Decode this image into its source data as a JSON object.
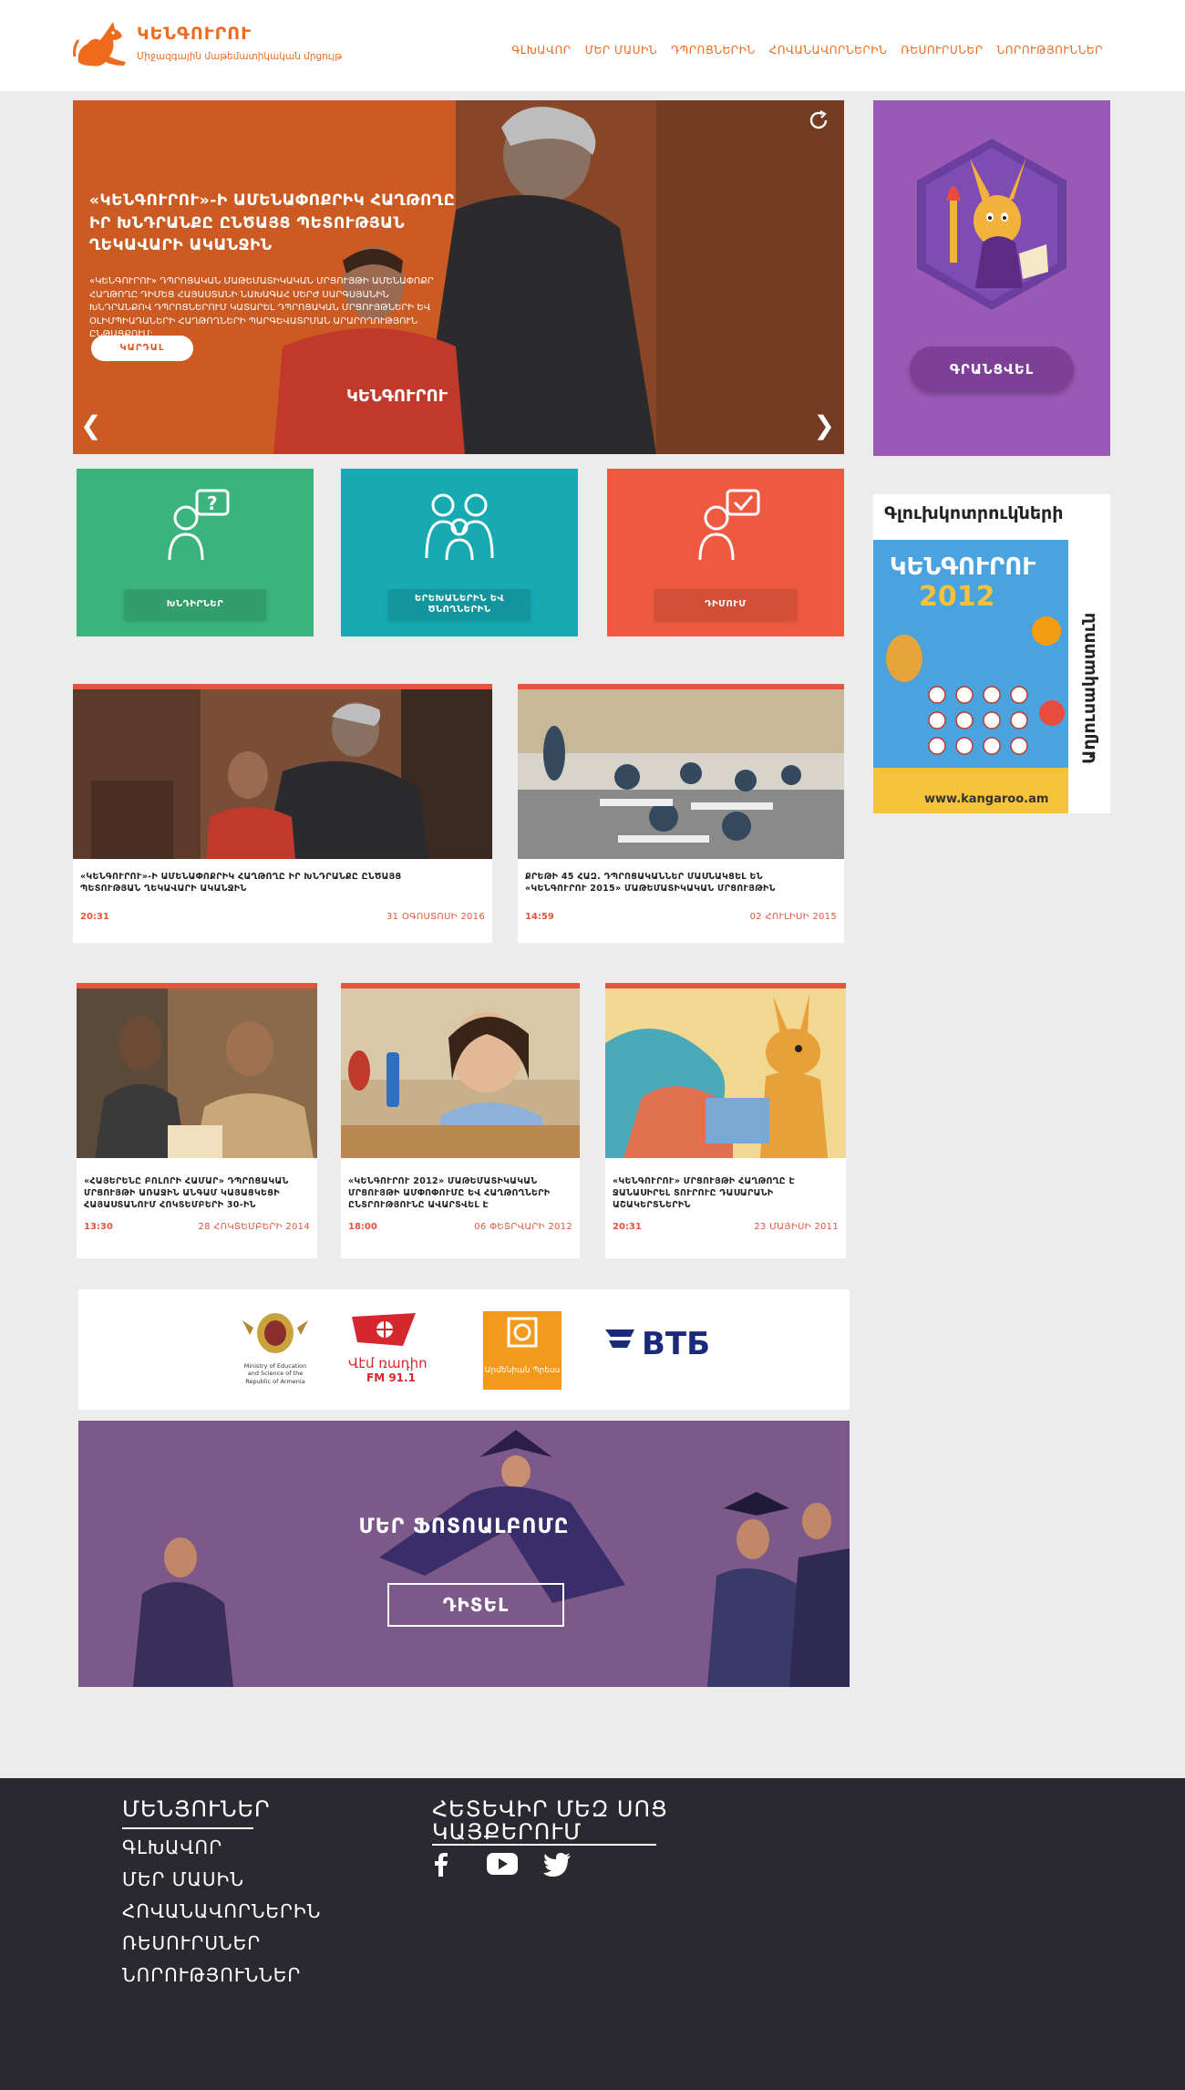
{
  "brand": {
    "name": "ԿԵՆԳՈՒՐՈՒ",
    "subtitle": "Միջազգային մաթեմատիկական մրցույթ",
    "accent": "#f06a1e"
  },
  "nav": [
    {
      "label": "ԳԼԽԱՎՈՐ"
    },
    {
      "label": "ՄԵՐ ՄԱՍԻՆ"
    },
    {
      "label": "ԴՊՐՈՑՆԵՐԻՆ"
    },
    {
      "label": "ՀՈՎԱՆԱՎՈՐՆԵՐԻՆ"
    },
    {
      "label": "ՌԵՍՈՒՐՍՆԵՐ"
    },
    {
      "label": "ՆՈՐՈՒԹՅՈՒՆՆԵՐ"
    }
  ],
  "hero": {
    "title": "«ԿԵՆԳՈՒՐՈՒ»-Ի ԱՄԵՆԱՓՈՔՐԻԿ ՀԱՂԹՈՂԸ ԻՐ ԽՆԴՐԱՆՔԸ ԸՆԾԱՅՑ ՊԵՏՈՒԹՅԱՆ ՂԵԿԱՎԱՐԻ ԱԿԱՆՋԻՆ",
    "text": "«ԿԵՆԳՈՒՐՈՒ» ԴՊՐՈՑԱԿԱՆ ՄԱԹԵՄԱՏԻԿԱԿԱՆ ՄՐՑՈՒՅԹԻ ԱՄԵՆԱՓՈՔՐ ՀԱՂԹՈՂԸ ԴԻՄԵՑ ՀԱՅԱՍՏԱՆԻ ՆԱԽԱԳԱՀ ՍԵՐԺ ՍԱՐԳՍՅԱՆԻՆ ԽՆԴՐԱՆՔՈՎ ԴՊՐՈՑՆԵՐՈՒՄ ԿԱՏԱՐԵԼ ԴՊՐՈՑԱԿԱՆ ՄՐՑՈՒՅԹՆԵՐԻ ԵՎ ՕԼԻՄՊԻԱԴԱՆԵՐԻ ՀԱՂԹՈՂՆԵՐԻ ՊԱՐԳԵՎԱՏՐՄԱՆ ԱՐԱՐՈՂՈՒԹՅՈՒՆ ԸՆԹԱՑՔՈՒՄ:",
    "button": "ԿԱՐԴԱԼ",
    "prev": "❮",
    "next": "❯"
  },
  "promo": {
    "button": "ԳՐԱՆՑՎԵԼ",
    "color": "#9b59b6"
  },
  "tiles": [
    {
      "label": "ԽՆԴԻՐՆԵՐ",
      "color": "#3bb37c",
      "icon": "child-question-icon"
    },
    {
      "label": "ԵՐԵԽԱՆԵՐԻՆ ԵՎ ԾՆՈՂՆԵՐԻՆ",
      "color": "#17aab3",
      "icon": "family-icon"
    },
    {
      "label": "ԴԻՄՈՒՄ",
      "color": "#ee5a3f",
      "icon": "child-check-icon"
    }
  ],
  "ad": {
    "title": "Գլուխկոտրուկների",
    "side": "Աղյուսակատուն",
    "poster_title": "ԿԵՆԳՈՒՐՈՒ",
    "poster_year": "2012",
    "poster_url": "www.kangaroo.am"
  },
  "news_big": [
    {
      "title": "«ԿԵՆԳՈՒՐՈՒ»-Ի ԱՄԵՆԱՓՈՔՐԻԿ ՀԱՂԹՈՂԸ ԻՐ ԽՆԴՐԱՆՔԸ ԸՆԾԱՅՑ ՊԵՏՈՒԹՅԱՆ ՂԵԿԱՎԱՐԻ ԱԿԱՆՋԻՆ",
      "time": "20:31",
      "date": "31 ՕԳՈՍՏՈՍԻ 2016"
    },
    {
      "title": "ՔՐԵԹԻ 45 ՀԱԶ. ԴՊՐՈՑԱԿԱՆՆԵՐ ՄԱՍՆԱԿՑԵԼ ԵՆ «ԿԵՆԳՈՒՐՈՒ 2015» ՄԱԹԵՄԱՏԻԿԱԿԱՆ ՄՐՑՈՒՅԹԻՆ",
      "time": "14:59",
      "date": "02 ՀՈՒԼԻՍԻ 2015"
    }
  ],
  "news_small": [
    {
      "title": "«ՀԱՅԵՐԵՆԸ ԲՈԼՈՐԻ ՀԱՄԱՐ» ԴՊՐՈՑԱԿԱՆ ՄՐՑՈՒՅԹԻ ԱՌԱՋԻՆ ԱՆԳԱՄ ԿԱՅԱՑԿԵՑԻ ՀԱՅԱՍՏԱՆՈՒՄ ՀՈԿՏԵՄԲԵՐԻ 30-ԻՆ",
      "time": "13:30",
      "date": "28 ՀՈԿՏԵՄԲԵՐԻ 2014"
    },
    {
      "title": "«ԿԵՆԳՈՒՐՈՒ 2012» ՄԱԹԵՄԱՏԻԿԱԿԱՆ ՄՐՑՈՒՅԹԻ ԱՄՓՈՓՈՒՄԸ ԵՎ ՀԱՂԹՈՂՆԵՐԻ ԸՆՏՐՈՒԹՅՈՒՆԸ ԱՎԱՐՏՎԵԼ Է",
      "time": "18:00",
      "date": "06 ՓԵՏՐՎԱՐԻ 2012"
    },
    {
      "title": "«ԿԵՆԳՈՒՐՈՒ» ՄՐՑՈՒՅԹԻ ՀԱՂԹՈՂԸ Է ՋԱՆԱՍԻՐԵԼ ՏՈՒՐՈՒԸ ԴԱՍԱՐԱՆԻ ԱՇԱԿԵՐՏՆԵՐԻՆ",
      "time": "20:31",
      "date": "23 ՄԱՅԻՍԻ 2011"
    }
  ],
  "partners": {
    "ministry": "Ministry of Education and Science of the Republic of Armenia",
    "radio_name": "Վէմ ռադիո",
    "radio_freq": "FM 91.1",
    "book": "Արմենիան Պրեսս",
    "bank": "ВТБ"
  },
  "album": {
    "title": "ՄԵՐ ՖՈՏՈԱԼԲՈՄԸ",
    "button": "ԴԻՏԵԼ"
  },
  "footer": {
    "menu_title": "ՄԵՆՅՈՒՆԵՐ",
    "links": [
      {
        "label": "ԳԼԽԱՎՈՐ"
      },
      {
        "label": "ՄԵՐ ՄԱՍԻՆ"
      },
      {
        "label": "ՀՈՎԱՆԱՎՈՐՆԵՐԻՆ"
      },
      {
        "label": "ՌԵՍՈՒՐՍՆԵՐ"
      },
      {
        "label": "ՆՈՐՈՒԹՅՈՒՆՆԵՐ"
      }
    ],
    "social_title_1": "ՀԵՏԵՎԻՐ ՄԵԶ ՍՈՑ",
    "social_title_2": "ԿԱՅՔԵՐՈՒՄ",
    "social": [
      "facebook-icon",
      "youtube-icon",
      "twitter-icon"
    ]
  }
}
